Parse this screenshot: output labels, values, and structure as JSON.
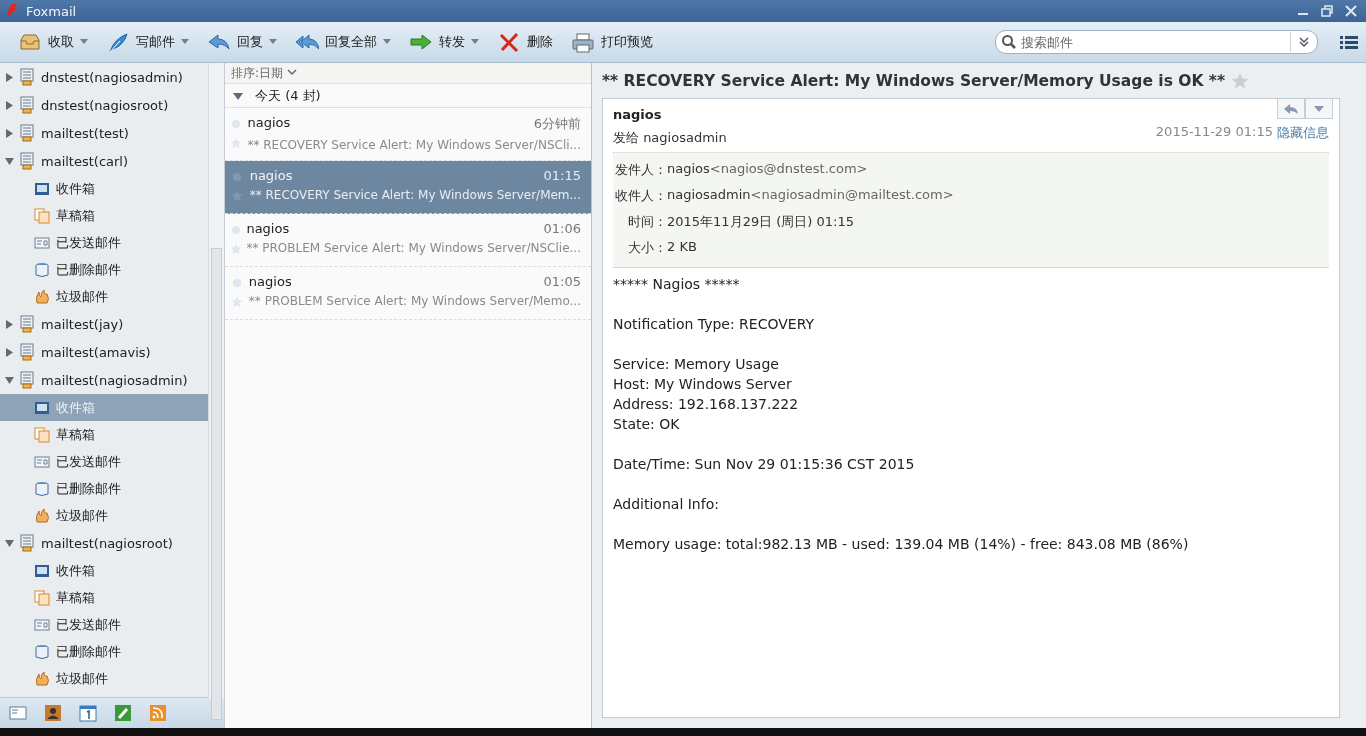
{
  "window": {
    "title": "Foxmail"
  },
  "toolbar": [
    {
      "label": "收取",
      "dropdown": true
    },
    {
      "label": "写邮件",
      "dropdown": true
    },
    {
      "label": "回复",
      "dropdown": true
    },
    {
      "label": "回复全部",
      "dropdown": true
    },
    {
      "label": "转发",
      "dropdown": true
    },
    {
      "label": "删除",
      "dropdown": false
    },
    {
      "label": "打印预览",
      "dropdown": false
    }
  ],
  "search": {
    "placeholder": "搜索邮件"
  },
  "sidebar": {
    "accounts": [
      {
        "name": "dnstest(nagiosadmin)",
        "expanded": false
      },
      {
        "name": "dnstest(nagiosroot)",
        "expanded": false
      },
      {
        "name": "mailtest(test)",
        "expanded": false
      },
      {
        "name": "mailtest(carl)",
        "expanded": true,
        "children": [
          {
            "kind": "inbox",
            "name": "收件箱",
            "selected": false
          },
          {
            "kind": "drafts",
            "name": "草稿箱",
            "selected": false
          },
          {
            "kind": "sent",
            "name": "已发送邮件",
            "selected": false
          },
          {
            "kind": "deleted",
            "name": "已删除邮件",
            "selected": false
          },
          {
            "kind": "junk",
            "name": "垃圾邮件",
            "selected": false
          }
        ]
      },
      {
        "name": "mailtest(jay)",
        "expanded": false
      },
      {
        "name": "mailtest(amavis)",
        "expanded": false
      },
      {
        "name": "mailtest(nagiosadmin)",
        "expanded": true,
        "children": [
          {
            "kind": "inbox",
            "name": "收件箱",
            "selected": true
          },
          {
            "kind": "drafts",
            "name": "草稿箱",
            "selected": false
          },
          {
            "kind": "sent",
            "name": "已发送邮件",
            "selected": false
          },
          {
            "kind": "deleted",
            "name": "已删除邮件",
            "selected": false
          },
          {
            "kind": "junk",
            "name": "垃圾邮件",
            "selected": false
          }
        ]
      },
      {
        "name": "mailtest(nagiosroot)",
        "expanded": true,
        "children": [
          {
            "kind": "inbox",
            "name": "收件箱",
            "selected": false
          },
          {
            "kind": "drafts",
            "name": "草稿箱",
            "selected": false
          },
          {
            "kind": "sent",
            "name": "已发送邮件",
            "selected": false
          },
          {
            "kind": "deleted",
            "name": "已删除邮件",
            "selected": false
          },
          {
            "kind": "junk",
            "name": "垃圾邮件",
            "selected": false
          }
        ]
      }
    ]
  },
  "message_list": {
    "sort": "排序:日期",
    "groups": [
      {
        "title": "今天 (4 封)",
        "expanded": true,
        "messages": [
          {
            "sender": "nagios",
            "time": "6分钟前",
            "subject": "** RECOVERY Service Alert: My Windows Server/NSCli...",
            "selected": false
          },
          {
            "sender": "nagios",
            "time": "01:15",
            "subject": "** RECOVERY Service Alert: My Windows Server/Mem...",
            "selected": true
          },
          {
            "sender": "nagios",
            "time": "01:06",
            "subject": "** PROBLEM Service Alert: My Windows Server/NSClie...",
            "selected": false
          },
          {
            "sender": "nagios",
            "time": "01:05",
            "subject": "** PROBLEM Service Alert: My Windows Server/Memo...",
            "selected": false
          }
        ]
      }
    ]
  },
  "reader": {
    "subject": "** RECOVERY Service Alert: My Windows Server/Memory Usage is OK **",
    "sender": "nagios",
    "sent_to": "发给 nagiosadmin",
    "date": "2015-11-29 01:15",
    "hide_details": "隐藏信息",
    "details": [
      {
        "label": "发件人：",
        "value": "nagios",
        "extra": "<nagios@dnstest.com>"
      },
      {
        "label": "收件人：",
        "value": "nagiosadmin",
        "extra": "<nagiosadmin@mailtest.com>"
      },
      {
        "label": "时间：",
        "value": "2015年11月29日 (周日) 01:15"
      },
      {
        "label": "大小：",
        "value": "2 KB"
      }
    ],
    "body": [
      [
        "***** Nagios *****"
      ],
      [
        "Notification Type: RECOVERY"
      ],
      [
        "Service: Memory Usage",
        "Host: My Windows Server",
        "Address: 192.168.137.222",
        "State: OK"
      ],
      [
        "Date/Time: Sun Nov 29 01:15:36 CST 2015"
      ],
      [
        "Additional Info:"
      ],
      [
        "Memory usage: total:982.13 MB - used: 139.04 MB (14%) - free: 843.08 MB (86%)"
      ]
    ]
  }
}
